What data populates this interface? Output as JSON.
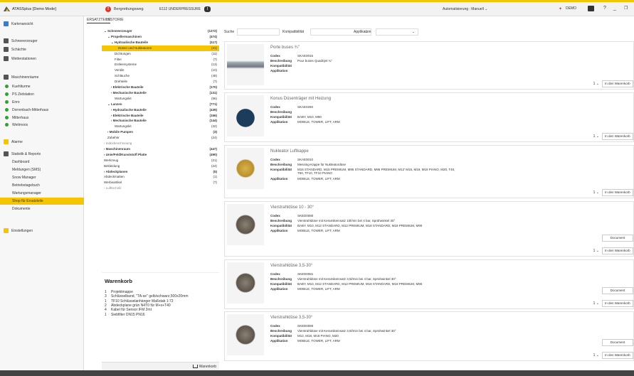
{
  "app": {
    "title": "ATASSplus   [Demo Mode]",
    "warning_text": "Bergrettungsweg",
    "warning_code": "E112 UNDERPRESSURE",
    "warning_badge": "!",
    "mode_label": "Automatisierung :  Manuell  ⌄",
    "demo_label": "DEMO",
    "help": "?",
    "minimize": "_",
    "maximize": "❐"
  },
  "sidebar": {
    "items": [
      {
        "label": "Kartenansicht",
        "type": "main",
        "icon": "map-icon"
      },
      {
        "label": "Schneeerzeuger",
        "type": "main",
        "icon": "snowmaker-icon"
      },
      {
        "label": "Schächte",
        "type": "main",
        "icon": "shaft-icon"
      },
      {
        "label": "Wetterstationen",
        "type": "main",
        "icon": "weather-station-icon"
      },
      {
        "label": "Maschinenräume",
        "type": "main",
        "icon": "machine-room-icon"
      },
      {
        "label": "Kuehlturme",
        "type": "sub"
      },
      {
        "label": "PS Zielstation",
        "type": "sub"
      },
      {
        "label": "Enro",
        "type": "sub"
      },
      {
        "label": "Dorrenbach-Mitterhaus",
        "type": "sub"
      },
      {
        "label": "Mitterhaus",
        "type": "sub"
      },
      {
        "label": "Weitmoos",
        "type": "sub"
      },
      {
        "label": "Alarme",
        "type": "main",
        "icon": "alarm-icon"
      },
      {
        "label": "Statistik & Reports",
        "type": "main",
        "icon": "statistics-icon"
      },
      {
        "label": "Dashboard",
        "type": "plain"
      },
      {
        "label": "Meldungen (SMS)",
        "type": "plain"
      },
      {
        "label": "Snow Manager",
        "type": "plain"
      },
      {
        "label": "Betriebstagebuch",
        "type": "plain"
      },
      {
        "label": "Wartungsmanager",
        "type": "plain"
      },
      {
        "label": "Shop für Ersatzteile",
        "type": "plain",
        "active": true
      },
      {
        "label": "Dokumente",
        "type": "plain"
      },
      {
        "label": "Einstellungen",
        "type": "main",
        "icon": "settings-icon"
      }
    ]
  },
  "tabs": [
    "ERSATZTEILE",
    "HISTORIE"
  ],
  "tree": [
    {
      "label": "⌄ Schneeerzeuger",
      "count": "(1272)",
      "indent": 0,
      "bold": true
    },
    {
      "label": "⌄ Propellermaschinen",
      "count": "(474)",
      "indent": 1,
      "bold": true
    },
    {
      "label": "⌄ Hydraulische Bauteile",
      "count": "(117)",
      "indent": 2,
      "bold": true
    },
    {
      "label": "Düsen und Nukleatoren",
      "count": "(21)",
      "indent": 4,
      "selected": true
    },
    {
      "label": "Dichtungen",
      "count": "(11)",
      "indent": 3
    },
    {
      "label": "Filter",
      "count": "(7)",
      "indent": 3
    },
    {
      "label": "Entleersysteme",
      "count": "(13)",
      "indent": 3
    },
    {
      "label": "Ventile",
      "count": "(10)",
      "indent": 3
    },
    {
      "label": "Schläuche",
      "count": "(48)",
      "indent": 3
    },
    {
      "label": "Drehteile",
      "count": "(7)",
      "indent": 3
    },
    {
      "label": "› Elektrische Bauteile",
      "count": "(170)",
      "indent": 2,
      "bold": true
    },
    {
      "label": "› Mechanische Bauteile",
      "count": "(131)",
      "indent": 2,
      "bold": true
    },
    {
      "label": "Wartungskit",
      "count": "(56)",
      "indent": 3
    },
    {
      "label": "⌄ Lanzen",
      "count": "(771)",
      "indent": 1,
      "bold": true
    },
    {
      "label": "› Hydraulische Bauteile",
      "count": "(439)",
      "indent": 2,
      "bold": true
    },
    {
      "label": "› Elektrische Bauteile",
      "count": "(156)",
      "indent": 2,
      "bold": true
    },
    {
      "label": "› Mechanische Bauteile",
      "count": "(144)",
      "indent": 2,
      "bold": true
    },
    {
      "label": "Wartungskit",
      "count": "(32)",
      "indent": 3
    },
    {
      "label": "› Mobile Pumpen",
      "count": "(3)",
      "indent": 1,
      "bold": true
    },
    {
      "label": "Zubehör",
      "count": "(24)",
      "indent": 1
    },
    {
      "label": "› Indexbeschneiung",
      "count": "",
      "indent": 0,
      "muted": true
    },
    {
      "label": "› Maschinenraum",
      "count": "(447)",
      "indent": 0,
      "bold": true
    },
    {
      "label": "› Unie/Feld/Kunststoff Platte",
      "count": "(490)",
      "indent": 0,
      "bold": true
    },
    {
      "label": "Werkzeug",
      "count": "(21)",
      "indent": 0
    },
    {
      "label": "Bekleidung",
      "count": "(24)",
      "indent": 0
    },
    {
      "label": "› Abdeckplanen",
      "count": "(5)",
      "indent": 0,
      "bold": true
    },
    {
      "label": "Abdeckmatten",
      "count": "(1)",
      "indent": 0
    },
    {
      "label": "Werbeartikel",
      "count": "(7)",
      "indent": 0
    },
    {
      "label": "› Lufttechnik",
      "count": "",
      "indent": 0,
      "muted": true
    }
  ],
  "cart": {
    "title": "Warenkorb",
    "items": [
      {
        "n": "1",
        "text": "Projektmappe"
      },
      {
        "n": "3",
        "text": "Schlüsselband, \"TA-se\" gelb/schwarz,500x20mm"
      },
      {
        "n": "1",
        "text": "TF10 Schlüsselanhänger Maßstab 1:72"
      },
      {
        "n": "2",
        "text": "Abdeckplane grün N4T0 für M+x+T40"
      },
      {
        "n": "4",
        "text": "Kabel für Sensor IFM 2mt"
      },
      {
        "n": "1",
        "text": "Siebfilter DN15 PN16"
      }
    ],
    "button": "Warenkorb"
  },
  "filters": {
    "search_label": "Suche",
    "compat_label": "Kompatibilität",
    "app_label": "Applikation",
    "chevron": "⌄"
  },
  "labels": {
    "code": "Codex",
    "desc": "Beschreibung",
    "compat": "Kompatibilität",
    "app": "Applikation",
    "add_to_cart": "In den Warenkorb",
    "document": "Document"
  },
  "products": [
    {
      "title": "Porte buses ¾\"",
      "code": "SKAE0015",
      "desc": "Pour buses Quadrijet ¾\"",
      "compat": "",
      "app": "",
      "qty": "1  ⌄",
      "doc": false
    },
    {
      "title": "Konus Düsenträger mit Heizung",
      "code": "SKAE0250",
      "desc": "",
      "compat": "BABY, M10, M90",
      "app": "MOBILE, TOWER, LIFT, ARM",
      "qty": "1  ⌄",
      "doc": false
    },
    {
      "title": "Nukleator Luftkappe",
      "code": "SKAE0010",
      "desc": "Messing-Kappe für Nukleatordüse",
      "compat": "M15 STANDARD, M15 PREMIUM, M95 STANDARD, M95 PREMIUM, M12' M15, M18, M18 PIANO, M20, T40, T60, TF10, TF10 PIANO",
      "app": "MOBILE, TOWER, LIFT, ARM",
      "qty": "1  ⌄",
      "doc": false
    },
    {
      "title": "Vierstrahldüse 10 - 30°",
      "code": "SKED0080",
      "desc": "Vierstrahldüse mit Keramikeinsatz 10l/min bei 4 bar, Sprühwinkel 30°",
      "compat": "BABY, M10, M12 STANDARD, M12 PREMIUM, M18 STANDARD, M18 PREMIUM, M90",
      "app": "MOBILE, TOWER, LIFT, ARM",
      "qty": "1  ⌄",
      "doc": true
    },
    {
      "title": "Vierstrahldüse 3,5-30°",
      "code": "SKED0081",
      "desc": "Vierstrahldüse mit Keramikeinsatz 3,5l/min bei 4 bar, Sprühwinkel 30°",
      "compat": "BABY, M10, M12 STANDARD, M12 PREMIUM, M18 STANDARD, M18 PREMIUM, M90",
      "app": "MOBILE, TOWER, LIFT, ARM",
      "qty": "1  ⌄",
      "doc": true
    },
    {
      "title": "Vierstrahldüse 3,5-30°",
      "code": "SKED0080",
      "desc": "Vierstrahldüse mit Keramikeinsatz 3,5l/min bei 4 bar, Sprühwinkel 30°",
      "compat": "M12, M18, M18 PIANO, M20",
      "app": "MOBILE, TOWER, LIFT, ARM",
      "qty": "1  ⌄",
      "doc": true
    }
  ],
  "colors": {
    "accent": "#f6c400",
    "alert": "#d9372b",
    "status_ok": "#2aa52a"
  }
}
